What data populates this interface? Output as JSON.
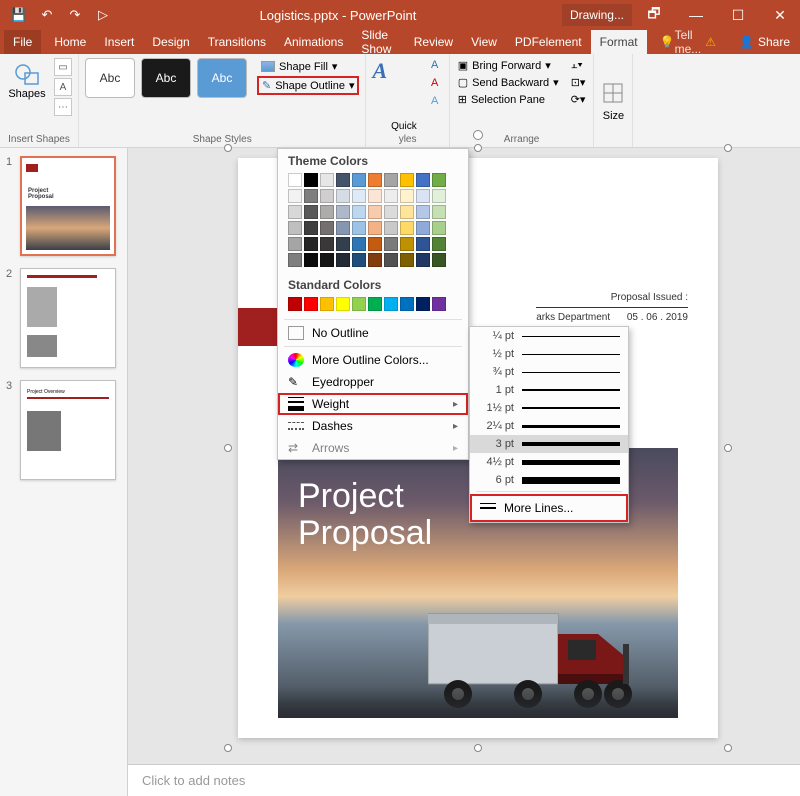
{
  "title": "Logistics.pptx - PowerPoint",
  "context_tab": "Drawing...",
  "tabs": {
    "file": "File",
    "home": "Home",
    "insert": "Insert",
    "design": "Design",
    "transitions": "Transitions",
    "animations": "Animations",
    "slideshow": "Slide Show",
    "review": "Review",
    "view": "View",
    "pdf": "PDFelement",
    "format": "Format",
    "tellme": "Tell me...",
    "share": "Share"
  },
  "ribbon": {
    "shapes_label": "Shapes",
    "insert_shapes_group": "Insert Shapes",
    "shape_styles_group": "Shape Styles",
    "wordart_styles_group": "yles",
    "arrange_group": "Arrange",
    "size_group": "Size",
    "shape_fill": "Shape Fill",
    "shape_outline": "Shape Outline",
    "quick": "Quick",
    "bring_forward": "Bring Forward",
    "send_backward": "Send Backward",
    "selection_pane": "Selection Pane",
    "abc": "Abc"
  },
  "dropdown": {
    "theme_colors": "Theme Colors",
    "theme_palette": [
      [
        "#ffffff",
        "#000000",
        "#e7e6e6",
        "#44546a",
        "#5b9bd5",
        "#ed7d31",
        "#a5a5a5",
        "#ffc000",
        "#4472c4",
        "#70ad47"
      ],
      [
        "#f2f2f2",
        "#7f7f7f",
        "#d0cece",
        "#d6dce4",
        "#deebf6",
        "#fbe5d5",
        "#ededed",
        "#fff2cc",
        "#dae3f3",
        "#e2efd9"
      ],
      [
        "#d8d8d8",
        "#595959",
        "#aeabab",
        "#adb9ca",
        "#bdd7ee",
        "#f7cbac",
        "#dbdbdb",
        "#fee599",
        "#b4c7e7",
        "#c5e0b3"
      ],
      [
        "#bfbfbf",
        "#3f3f3f",
        "#757070",
        "#8496b0",
        "#9cc3e5",
        "#f4b183",
        "#c9c9c9",
        "#ffd965",
        "#8eaadb",
        "#a8d08d"
      ],
      [
        "#a5a5a5",
        "#262626",
        "#3a3838",
        "#323f4f",
        "#2e75b5",
        "#c55a11",
        "#7b7b7b",
        "#bf9000",
        "#2f5496",
        "#538135"
      ],
      [
        "#7f7f7f",
        "#0c0c0c",
        "#171616",
        "#222a35",
        "#1e4e79",
        "#833c0b",
        "#525252",
        "#7f6000",
        "#1f3864",
        "#375623"
      ]
    ],
    "standard_colors": "Standard Colors",
    "standard_palette": [
      "#c00000",
      "#ff0000",
      "#ffc000",
      "#ffff00",
      "#92d050",
      "#00b050",
      "#00b0f0",
      "#0070c0",
      "#002060",
      "#7030a0"
    ],
    "no_outline": "No Outline",
    "more_colors": "More Outline Colors...",
    "eyedropper": "Eyedropper",
    "weight": "Weight",
    "dashes": "Dashes",
    "arrows": "Arrows"
  },
  "weights": [
    {
      "label": "¼ pt",
      "h": 1
    },
    {
      "label": "½ pt",
      "h": 1
    },
    {
      "label": "¾ pt",
      "h": 1
    },
    {
      "label": "1 pt",
      "h": 1.5
    },
    {
      "label": "1½ pt",
      "h": 2
    },
    {
      "label": "2¼ pt",
      "h": 3
    },
    {
      "label": "3 pt",
      "h": 4,
      "selected": true
    },
    {
      "label": "4½ pt",
      "h": 5
    },
    {
      "label": "6 pt",
      "h": 7
    }
  ],
  "more_lines": "More Lines...",
  "slide": {
    "title_line1": "Project",
    "title_line2": "Proposal",
    "meta_label": "Proposal Issued :",
    "meta_date": "05 . 06 . 2019",
    "meta_dept": "arks Department"
  },
  "thumbs": {
    "n1": "1",
    "n2": "2",
    "n3": "3"
  },
  "notes": "Click to add notes"
}
